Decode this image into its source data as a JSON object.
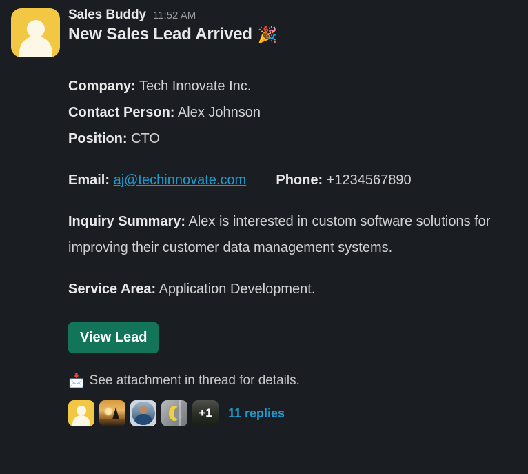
{
  "theme": {
    "background": "#1a1d21",
    "text": "#d1d2d3",
    "heading": "#e8e8e9",
    "link": "#1d9bd1",
    "button_bg": "#12755a",
    "avatar_bg": "#f2c744"
  },
  "message": {
    "sender": "Sales Buddy",
    "timestamp": "11:52 AM",
    "headline": "New Sales Lead Arrived",
    "headline_emoji": "🎉",
    "avatar_icon": "person-avatar-icon",
    "fields": {
      "company_label": "Company:",
      "company_value": "Tech Innovate Inc.",
      "contact_label": "Contact Person:",
      "contact_value": "Alex Johnson",
      "position_label": "Position:",
      "position_value": "CTO",
      "email_label": "Email:",
      "email_value": "aj@techinnovate.com",
      "phone_label": "Phone:",
      "phone_value": "+1234567890",
      "inquiry_label": "Inquiry Summary:",
      "inquiry_value": "Alex is interested in custom software solutions for improving their customer data management systems.",
      "service_label": "Service Area:",
      "service_value": "Application Development."
    },
    "button_label": "View Lead",
    "attachment_emoji": "📩",
    "attachment_note": "See attachment in thread for details."
  },
  "thread": {
    "replies_label": "11 replies",
    "overflow_count": "+1",
    "participants": [
      {
        "name": "avatar-person-yellow"
      },
      {
        "name": "avatar-sunset-sailboat"
      },
      {
        "name": "avatar-portrait-photo"
      },
      {
        "name": "avatar-gray-crescent"
      },
      {
        "name": "avatar-dark-photo-overflow"
      }
    ]
  }
}
